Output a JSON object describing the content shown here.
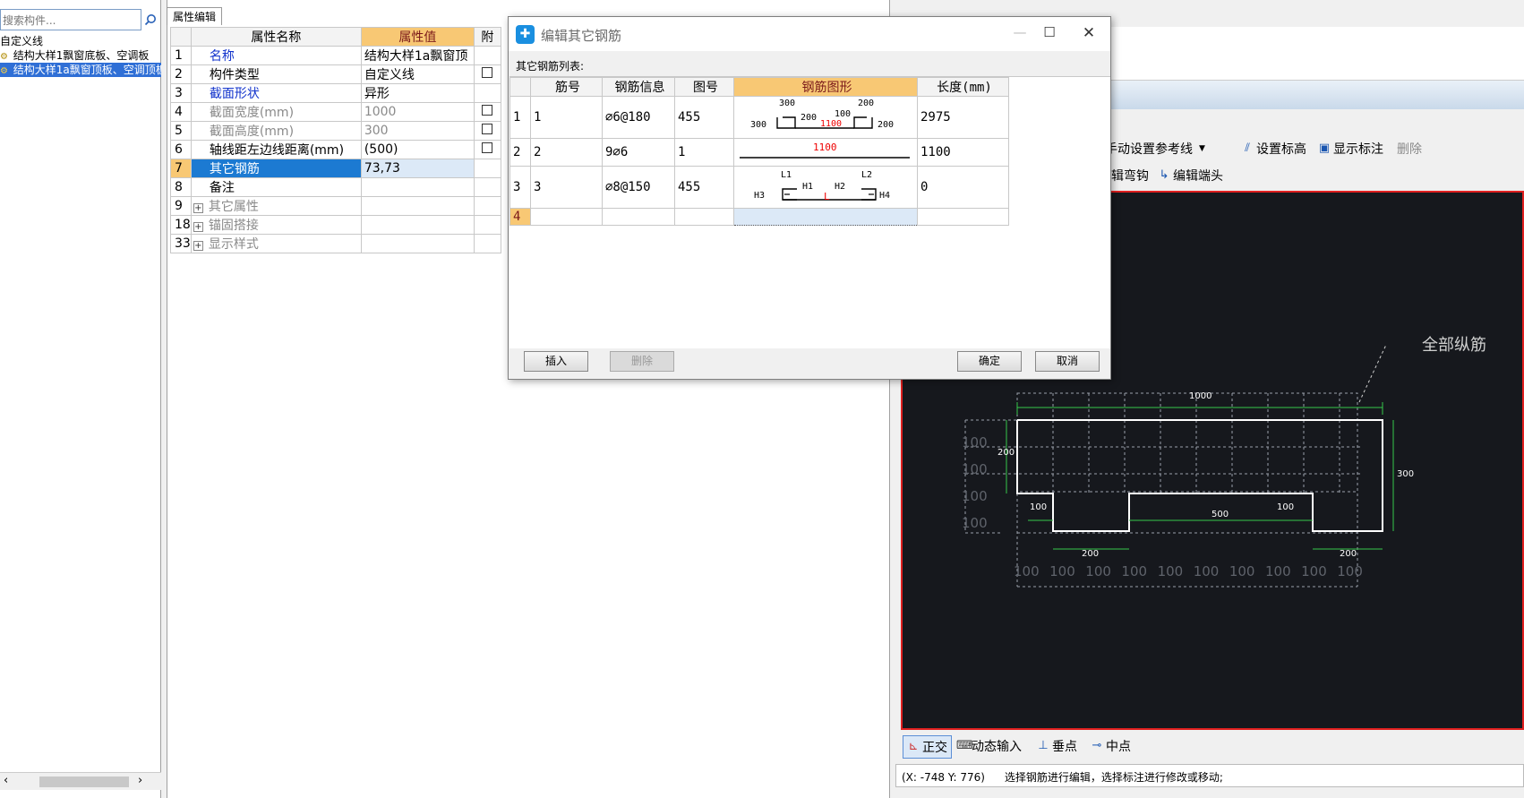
{
  "left_panel": {
    "search_placeholder": "搜索构件...",
    "tree": [
      {
        "label": "自定义线",
        "selected": false
      },
      {
        "label": "结构大样1飘窗底板、空调板",
        "selected": false
      },
      {
        "label": "结构大样1a飘窗顶板、空调顶板",
        "selected": true
      }
    ]
  },
  "prop_panel": {
    "tab_label": "属性编辑",
    "headers": {
      "name": "属性名称",
      "value": "属性值",
      "extra": "附"
    },
    "rows": [
      {
        "num": "1",
        "name": "名称",
        "value": "结构大样1a飘窗顶",
        "style": "blue",
        "checkbox": false,
        "expander": false
      },
      {
        "num": "2",
        "name": "构件类型",
        "value": "自定义线",
        "style": "normal",
        "checkbox": true,
        "expander": false
      },
      {
        "num": "3",
        "name": "截面形状",
        "value": "异形",
        "style": "blue",
        "checkbox": false,
        "expander": false
      },
      {
        "num": "4",
        "name": "截面宽度(mm)",
        "value": "1000",
        "style": "gray",
        "checkbox": true,
        "expander": false
      },
      {
        "num": "5",
        "name": "截面高度(mm)",
        "value": "300",
        "style": "gray",
        "checkbox": true,
        "expander": false
      },
      {
        "num": "6",
        "name": "轴线距左边线距离(mm)",
        "value": "(500)",
        "style": "normal",
        "checkbox": true,
        "expander": false
      },
      {
        "num": "7",
        "name": "其它钢筋",
        "value": "73,73",
        "style": "selected",
        "checkbox": false,
        "expander": false
      },
      {
        "num": "8",
        "name": "备注",
        "value": "",
        "style": "normal",
        "checkbox": false,
        "expander": false
      },
      {
        "num": "9",
        "name": "其它属性",
        "value": "",
        "style": "gray",
        "checkbox": false,
        "expander": true
      },
      {
        "num": "18",
        "name": "锚固搭接",
        "value": "",
        "style": "gray",
        "checkbox": false,
        "expander": true
      },
      {
        "num": "33",
        "name": "显示样式",
        "value": "",
        "style": "gray",
        "checkbox": false,
        "expander": true
      }
    ]
  },
  "dialog": {
    "title": "编辑其它钢筋",
    "subtitle": "其它钢筋列表:",
    "headers": [
      "筋号",
      "钢筋信息",
      "图号",
      "钢筋图形",
      "长度(mm)"
    ],
    "rows": [
      {
        "row": "1",
        "bar_no": "1",
        "info": "⌀6@180",
        "fig_no": "455",
        "length": "2975",
        "shape_labels": {
          "a": "300",
          "b": "200",
          "c": "100",
          "d": "200",
          "left": "300",
          "right": "200",
          "mid": "1100"
        }
      },
      {
        "row": "2",
        "bar_no": "2",
        "info": "9⌀6",
        "fig_no": "1",
        "length": "1100",
        "shape_labels": {
          "mid": "1100"
        }
      },
      {
        "row": "3",
        "bar_no": "3",
        "info": "⌀8@150",
        "fig_no": "455",
        "length": "0",
        "shape_labels": {
          "l1": "L1",
          "l2": "L2",
          "h1": "H1",
          "h2": "H2",
          "h3": "H3",
          "h4": "H4",
          "mid": "L"
        }
      },
      {
        "row": "4",
        "bar_no": "",
        "info": "",
        "fig_no": "",
        "length": "",
        "shape_labels": {}
      }
    ],
    "buttons": {
      "insert": "插入",
      "delete": "删除",
      "ok": "确定",
      "cancel": "取消"
    }
  },
  "cad_toolbar": {
    "row1": [
      "手动设置参考线",
      "设置标高",
      "显示标注",
      "删除"
    ],
    "row2": [
      "辑弯钩",
      "编辑端头"
    ]
  },
  "cad": {
    "label_all": "全部纵筋",
    "dim_top": "1000",
    "dim_left": "200",
    "dim_right": "300",
    "dim_mid": "500",
    "dim_notch_left": "100",
    "dim_notch_right": "100",
    "dim_bottom_left": "200",
    "dim_bottom_right": "200",
    "grid_labels": [
      "100",
      "100",
      "100",
      "100",
      "100",
      "100",
      "100",
      "100",
      "100",
      "100"
    ],
    "side_labels": [
      "100",
      "100",
      "100",
      "100"
    ]
  },
  "snap_bar": [
    "正交",
    "动态输入",
    "垂点",
    "中点"
  ],
  "status": {
    "coords": "(X: -748 Y: 776)",
    "message": "选择钢筋进行编辑，选择标注进行修改或移动;"
  },
  "colors": {
    "accent_orange": "#f8c874",
    "select_blue": "#1c7ad2",
    "cad_bg": "#16181d",
    "cad_border": "#e02020",
    "dim_green": "#37c84b"
  }
}
